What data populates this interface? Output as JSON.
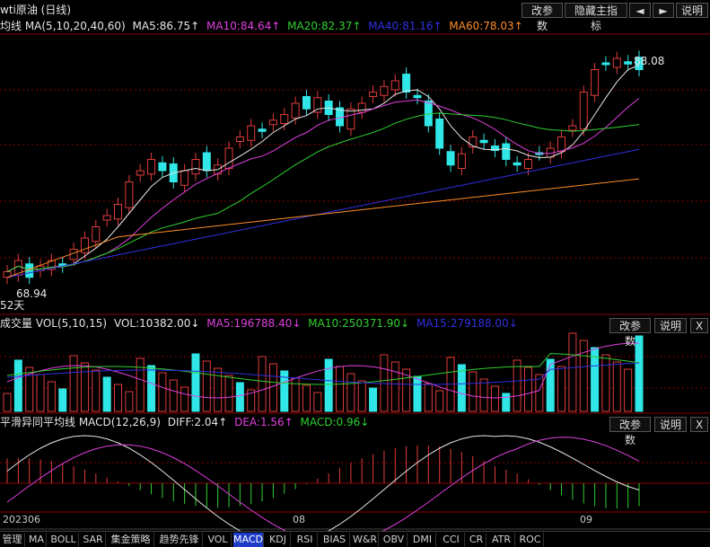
{
  "header": {
    "title": "wti原油 (日线)",
    "buttons": [
      "改参数",
      "隐藏主指标",
      "◄",
      "►",
      "说明"
    ]
  },
  "main": {
    "legend_prefix": "均线 MA(5,10,20,40,60)",
    "ma": [
      {
        "text": "MA5:86.75↑",
        "color": "#e6e6e6"
      },
      {
        "text": "MA10:84.64↑",
        "color": "#e040e0"
      },
      {
        "text": "MA20:82.37↑",
        "color": "#30d030"
      },
      {
        "text": "MA40:81.16↑",
        "color": "#3030e0"
      },
      {
        "text": "MA60:78.03↑",
        "color": "#ff8c28"
      }
    ],
    "high_label": "88.08",
    "low_label": "68.94",
    "days_label": "52天"
  },
  "volume": {
    "legend_prefix": "成交量 VOL(5,10,15)",
    "vol": "VOL:10382.00↓",
    "ma": [
      {
        "text": "MA5:196788.40↓",
        "color": "#e040e0"
      },
      {
        "text": "MA10:250371.90↓",
        "color": "#30d030"
      },
      {
        "text": "MA15:279188.00↓",
        "color": "#3030e0"
      }
    ],
    "buttons": [
      "改参数",
      "说明",
      "X"
    ]
  },
  "macd": {
    "legend_prefix": "平滑异同平均线 MACD(12,26,9)",
    "diff": "DIFF:2.04↑",
    "dea": "DEA:1.56↑",
    "macd": "MACD:0.96↓",
    "colors": {
      "diff": "#e6e6e6",
      "dea": "#e040e0",
      "macd": "#30d030"
    },
    "buttons": [
      "改参数",
      "说明",
      "X"
    ]
  },
  "dates": [
    "202306",
    "08",
    "09"
  ],
  "tabs": [
    "管理",
    "MA",
    "BOLL",
    "SAR",
    "集金策略",
    "趋势先锋",
    "VOL",
    "MACD",
    "KDJ",
    "RSI",
    "BIAS",
    "W&R",
    "OBV",
    "DMI",
    "CCI",
    "CR",
    "ATR",
    "ROC"
  ],
  "active_tab": "MACD",
  "colors": {
    "up": "#e03c3c",
    "down": "#30e6e6",
    "grid": "#8b0000"
  }
}
